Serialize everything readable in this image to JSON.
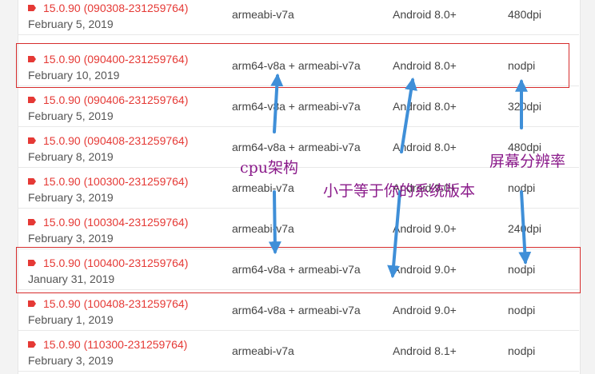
{
  "rows": [
    {
      "version": "15.0.90 (090308-231259764)",
      "date": "February 5, 2019",
      "arch": "armeabi-v7a",
      "android": "Android 8.0+",
      "dpi": "480dpi"
    },
    {
      "version": "15.0.90 (090400-231259764)",
      "date": "February 10, 2019",
      "arch": "arm64-v8a + armeabi-v7a",
      "android": "Android 8.0+",
      "dpi": "nodpi"
    },
    {
      "version": "15.0.90 (090406-231259764)",
      "date": "February 5, 2019",
      "arch": "arm64-v8a + armeabi-v7a",
      "android": "Android 8.0+",
      "dpi": "320dpi"
    },
    {
      "version": "15.0.90 (090408-231259764)",
      "date": "February 8, 2019",
      "arch": "arm64-v8a + armeabi-v7a",
      "android": "Android 8.0+",
      "dpi": "480dpi"
    },
    {
      "version": "15.0.90 (100300-231259764)",
      "date": "February 3, 2019",
      "arch": "armeabi-v7a",
      "android": "Android 9.0+",
      "dpi": "nodpi"
    },
    {
      "version": "15.0.90 (100304-231259764)",
      "date": "February 3, 2019",
      "arch": "armeabi-v7a",
      "android": "Android 9.0+",
      "dpi": "240dpi"
    },
    {
      "version": "15.0.90 (100400-231259764)",
      "date": "January 31, 2019",
      "arch": "arm64-v8a + armeabi-v7a",
      "android": "Android 9.0+",
      "dpi": "nodpi"
    },
    {
      "version": "15.0.90 (100408-231259764)",
      "date": "February 1, 2019",
      "arch": "arm64-v8a + armeabi-v7a",
      "android": "Android 9.0+",
      "dpi": "nodpi"
    },
    {
      "version": "15.0.90 (110300-231259764)",
      "date": "February 3, 2019",
      "arch": "armeabi-v7a",
      "android": "Android 8.1+",
      "dpi": "nodpi"
    }
  ],
  "annotations": {
    "cpu": "cpu架构",
    "system": "小于等于你的系统版本",
    "screen": "屏幕分辨率"
  },
  "colors": {
    "version_text": "#e53935",
    "highlight_box": "#d62c2c",
    "arrow": "#3f8fd8",
    "annotation_text": "#8a1a8a"
  },
  "icons": {
    "version_tag": "tag-icon",
    "arrow": "arrow-icon"
  }
}
